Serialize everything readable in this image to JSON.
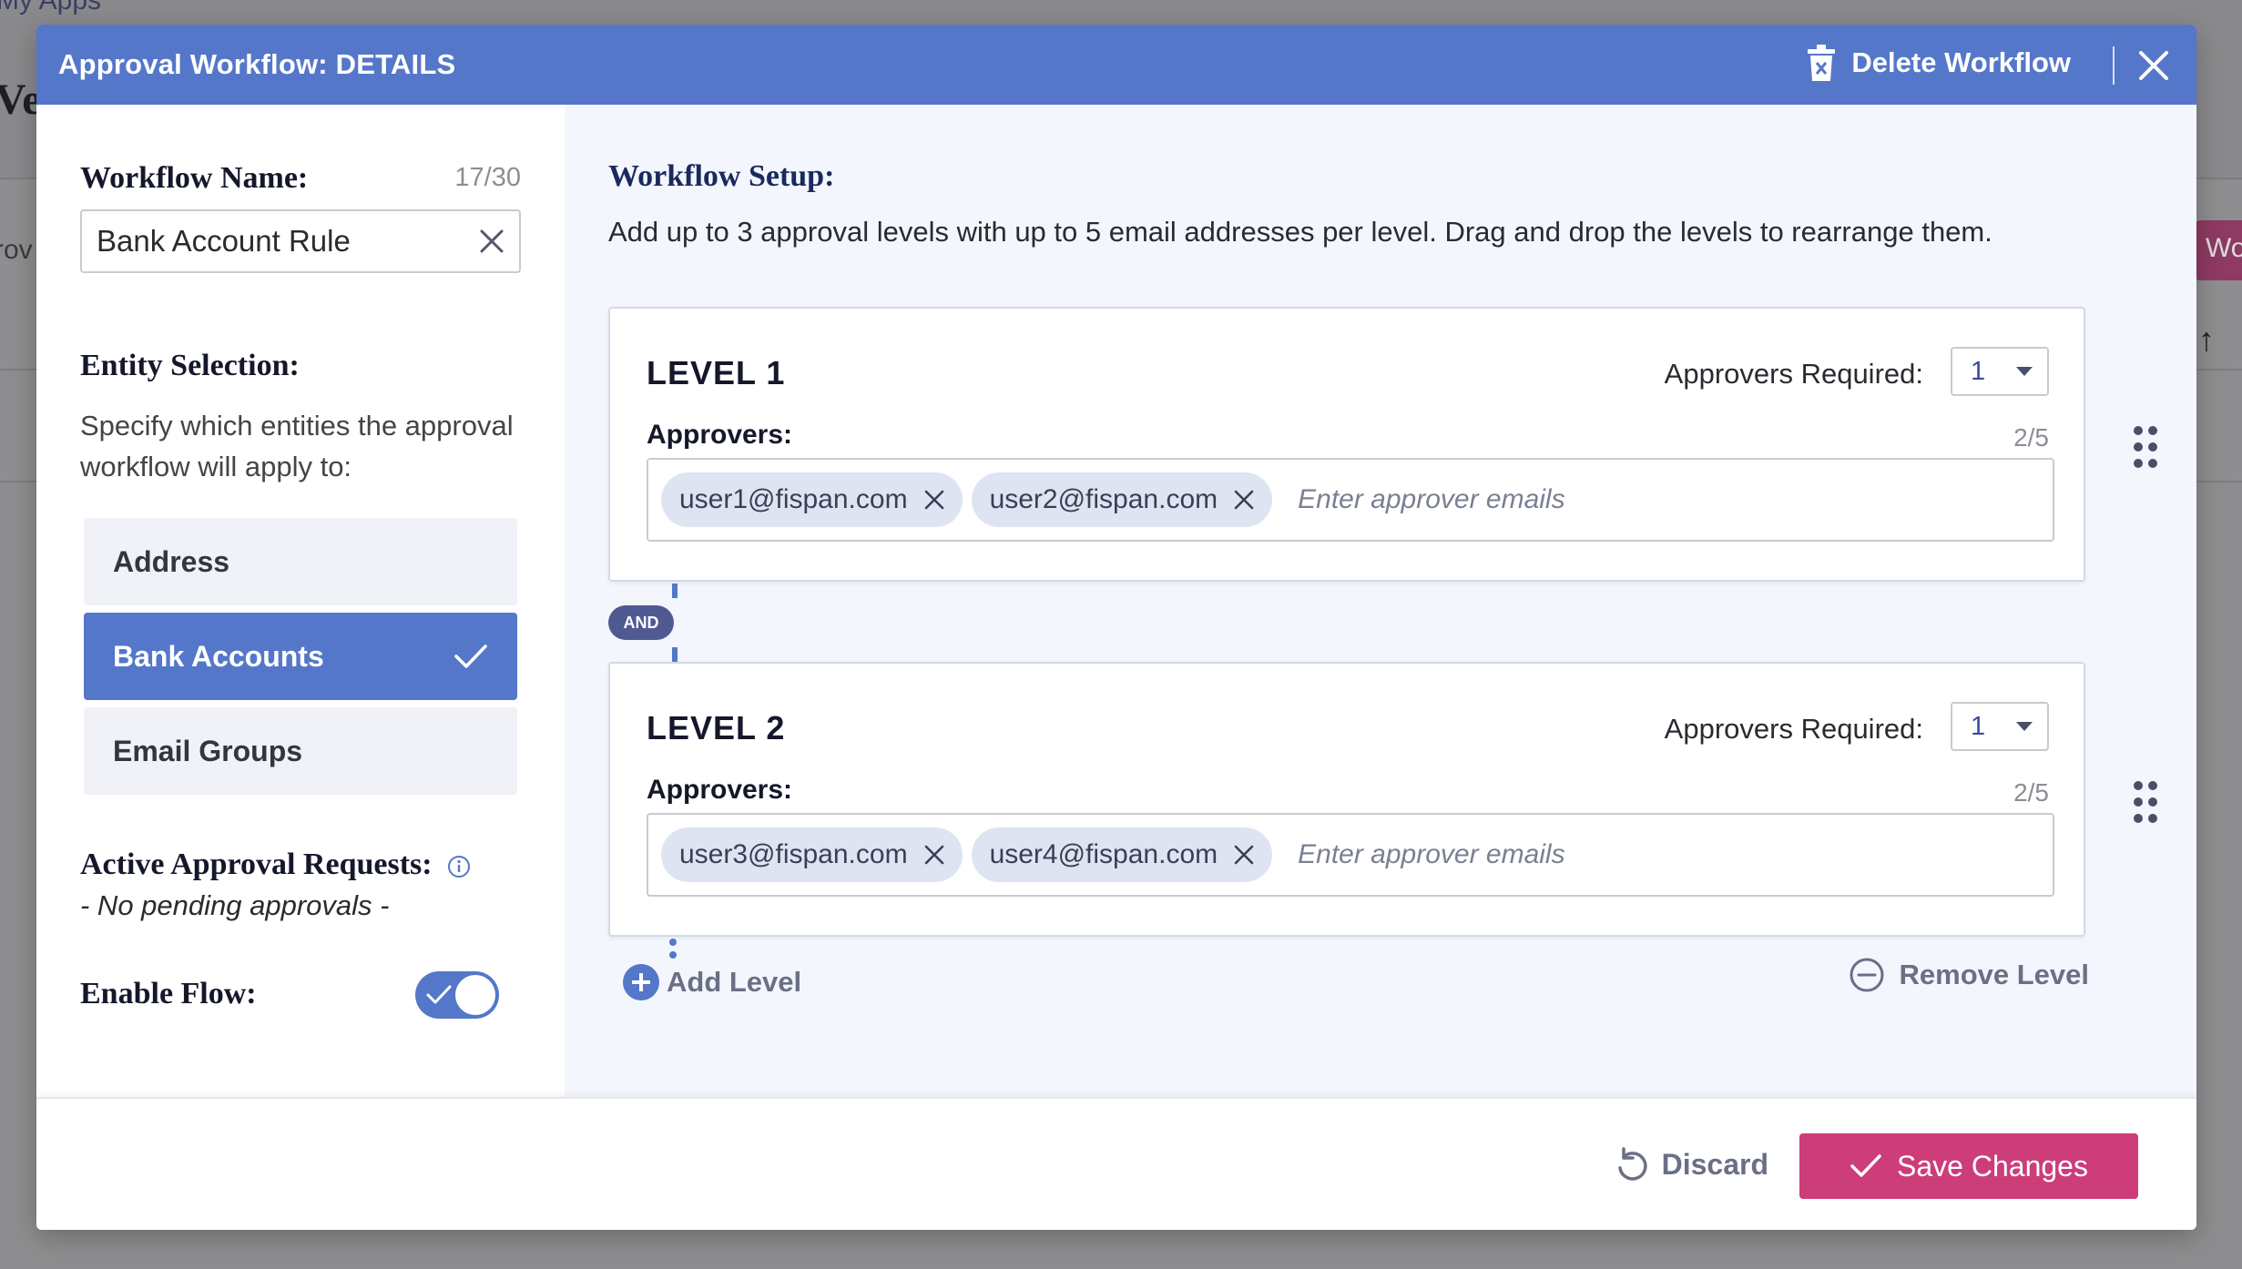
{
  "background": {
    "breadcrumb": "My Apps",
    "title_fragment": "Ve",
    "left_fragment": "rov",
    "right_button_fragment": "Wor"
  },
  "modal": {
    "title": "Approval Workflow: DETAILS",
    "delete_label": "Delete Workflow"
  },
  "left_panel": {
    "workflow_name_label": "Workflow Name:",
    "workflow_name_counter": "17/30",
    "workflow_name_value": "Bank Account Rule",
    "entity_selection_label": "Entity Selection:",
    "entity_selection_desc": "Specify which entities the approval workflow will apply to:",
    "entities": [
      {
        "label": "Address",
        "selected": false
      },
      {
        "label": "Bank Accounts",
        "selected": true
      },
      {
        "label": "Email Groups",
        "selected": false
      }
    ],
    "active_requests_label": "Active Approval Requests:",
    "no_pending": "- No pending approvals -",
    "enable_flow_label": "Enable Flow:",
    "enable_flow_on": true
  },
  "workflow_setup": {
    "title": "Workflow Setup:",
    "description": "Add up to 3 approval levels with up to 5 email addresses per level. Drag and drop the levels to rearrange them.",
    "and_label": "AND",
    "levels": [
      {
        "title": "LEVEL 1",
        "approvers_required_label": "Approvers Required:",
        "approvers_required_value": "1",
        "approvers_label": "Approvers:",
        "approvers_count": "2/5",
        "approvers": [
          "user1@fispan.com",
          "user2@fispan.com"
        ],
        "placeholder": "Enter approver emails"
      },
      {
        "title": "LEVEL 2",
        "approvers_required_label": "Approvers Required:",
        "approvers_required_value": "1",
        "approvers_label": "Approvers:",
        "approvers_count": "2/5",
        "approvers": [
          "user3@fispan.com",
          "user4@fispan.com"
        ],
        "placeholder": "Enter approver emails"
      }
    ],
    "add_level_label": "Add Level",
    "remove_level_label": "Remove Level"
  },
  "footer": {
    "discard_label": "Discard",
    "save_label": "Save Changes"
  },
  "colors": {
    "header_blue": "#5577c9",
    "save_pink": "#cc3d7a",
    "and_pill": "#4f5a92"
  }
}
